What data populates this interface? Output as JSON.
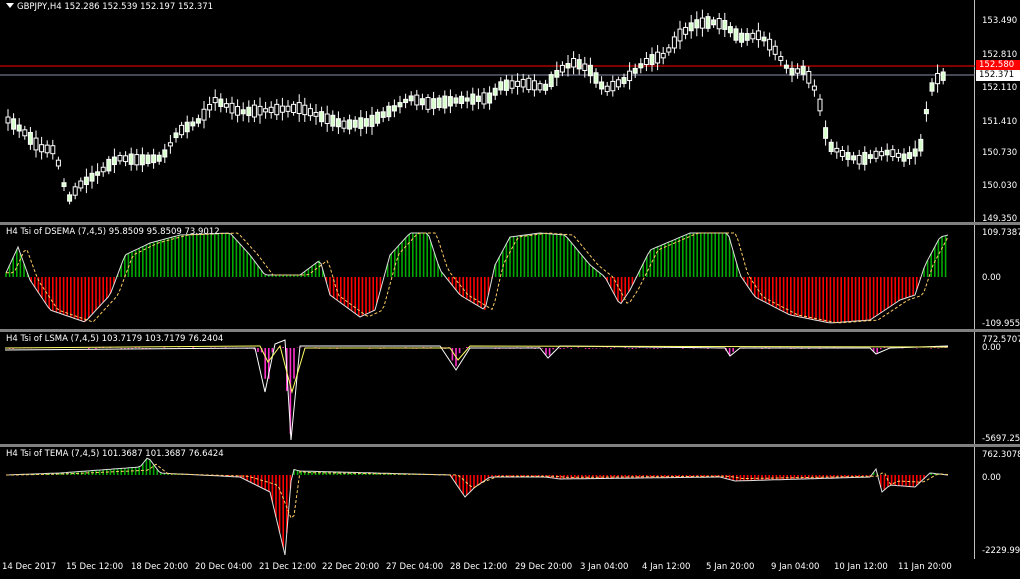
{
  "main": {
    "title": "GBPJPY,H4  152.286 152.539 152.197 152.371",
    "y_labels": [
      "153.490",
      "152.810",
      "152.110",
      "151.410",
      "150.730",
      "150.030",
      "149.350"
    ],
    "red_tag": "152.580",
    "bid_tag": "152.371",
    "colors": {
      "bull": "#d6ffcc",
      "bear": "#ffffff",
      "red_line": "#ff0000",
      "bid_line": "#8a8fa8"
    }
  },
  "dsema": {
    "title": "H4 Tsi of DSEMA (7,4,5) 95.8509 95.8509 73.9012",
    "y_labels": [
      "109.7387",
      "0.00",
      "-109.9555"
    ],
    "colors": {
      "pos": "#00aa00",
      "neg": "#ff0000"
    }
  },
  "lsma": {
    "title": "H4 Tsi of LSMA (7,4,5) 103.7179 103.7179 76.2404",
    "y_labels": [
      "772.5707",
      "0.00",
      "-5697.250"
    ],
    "colors": {
      "spike": "#ff33cc",
      "line": "#ffff66"
    }
  },
  "tema": {
    "title": "H4 Tsi of TEMA (7,4,5) 101.3687 101.3687 76.6424",
    "y_labels": [
      "762.3078",
      "0.00",
      "-2229.999"
    ],
    "colors": {
      "pos": "#00aa00",
      "neg": "#ff0000"
    }
  },
  "x_axis": [
    "14 Dec 2017",
    "15 Dec 12:00",
    "18 Dec 20:00",
    "20 Dec 04:00",
    "21 Dec 12:00",
    "22 Dec 20:00",
    "27 Dec 04:00",
    "28 Dec 12:00",
    "29 Dec 20:00",
    "3 Jan 04:00",
    "4 Jan 12:00",
    "5 Jan 20:00",
    "9 Jan 04:00",
    "10 Jan 12:00",
    "11 Jan 20:00"
  ]
}
